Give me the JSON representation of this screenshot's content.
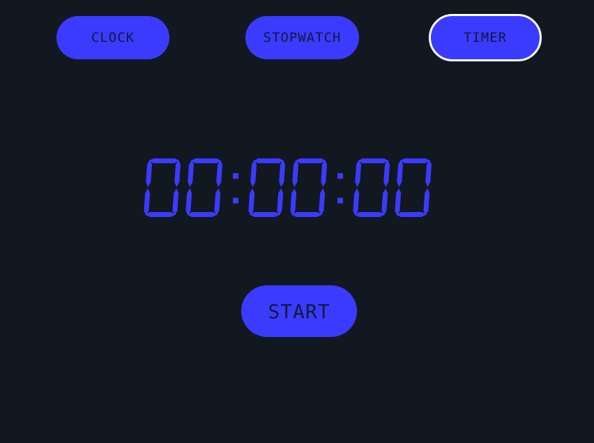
{
  "tabs": {
    "clock": "CLOCK",
    "stopwatch": "STOPWATCH",
    "timer": "TIMER"
  },
  "active_tab": "timer",
  "display": {
    "time": "00:00:00"
  },
  "controls": {
    "start_label": "START"
  },
  "colors": {
    "background": "#111820",
    "accent": "#3b3bff",
    "label_text": "#111a3a",
    "active_border": "#ffffff"
  }
}
